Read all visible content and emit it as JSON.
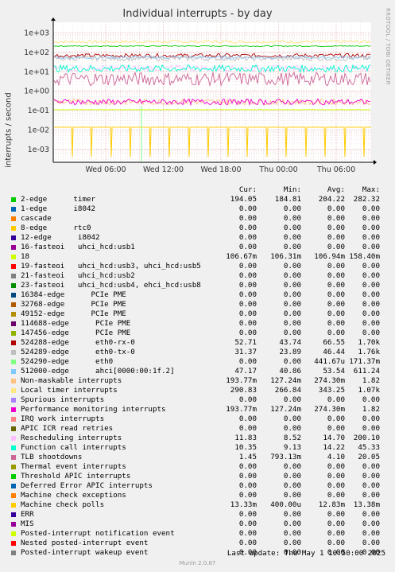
{
  "title": "Individual interrupts - by day",
  "side_label": "RRDTOOL / TOBI OETIKER",
  "version": "Munin 2.0.67",
  "last_update": "Last update: Thu May  1 10:50:00 2025",
  "chart_data": {
    "type": "line",
    "title": "Individual interrupts - by day",
    "ylabel": "interrupts / second",
    "yscale": "log",
    "ylim": [
      0.0005,
      3000
    ],
    "yticks": [
      "1e+03",
      "1e+02",
      "1e+01",
      "1e+00",
      "1e-01",
      "1e-02",
      "1e-03"
    ],
    "ytick_values": [
      1000,
      100,
      10,
      1,
      0.1,
      0.01,
      0.001
    ],
    "xticks": [
      "Wed 06:00",
      "Wed 12:00",
      "Wed 18:00",
      "Thu 00:00",
      "Thu 06:00"
    ],
    "grid": true,
    "series": [
      {
        "name": "2-edge timer",
        "color": "#00cc00",
        "cur": "194.05",
        "min": "184.81",
        "avg": "204.22",
        "max": "282.32"
      },
      {
        "name": "1-edge i8042",
        "color": "#0066b3",
        "cur": "0.00",
        "min": "0.00",
        "avg": "0.00",
        "max": "0.00"
      },
      {
        "name": "cascade",
        "color": "#ff8000",
        "cur": "0.00",
        "min": "0.00",
        "avg": "0.00",
        "max": "0.00"
      },
      {
        "name": "8-edge rtc0",
        "color": "#ffcc00",
        "cur": "0.00",
        "min": "0.00",
        "avg": "0.00",
        "max": "0.00"
      },
      {
        "name": "12-edge i8042",
        "color": "#330099",
        "cur": "0.00",
        "min": "0.00",
        "avg": "0.00",
        "max": "0.00"
      },
      {
        "name": "16-fasteoi uhci_hcd:usb1",
        "color": "#990099",
        "cur": "0.00",
        "min": "0.00",
        "avg": "0.00",
        "max": "0.00"
      },
      {
        "name": "18",
        "color": "#ccff00",
        "cur": "106.67m",
        "min": "106.31m",
        "avg": "106.94m",
        "max": "158.40m"
      },
      {
        "name": "19-fasteoi uhci_hcd:usb3, uhci_hcd:usb5",
        "color": "#ff0000",
        "cur": "0.00",
        "min": "0.00",
        "avg": "0.00",
        "max": "0.00"
      },
      {
        "name": "21-fasteoi uhci_hcd:usb2",
        "color": "#808080",
        "cur": "0.00",
        "min": "0.00",
        "avg": "0.00",
        "max": "0.00"
      },
      {
        "name": "23-fasteoi uhci_hcd:usb4, ehci_hcd:usb8",
        "color": "#008f00",
        "cur": "0.00",
        "min": "0.00",
        "avg": "0.00",
        "max": "0.00"
      },
      {
        "name": "16384-edge PCIe PME",
        "color": "#00487d",
        "cur": "0.00",
        "min": "0.00",
        "avg": "0.00",
        "max": "0.00"
      },
      {
        "name": "32768-edge PCIe PME",
        "color": "#b35a00",
        "cur": "0.00",
        "min": "0.00",
        "avg": "0.00",
        "max": "0.00"
      },
      {
        "name": "49152-edge PCIe PME",
        "color": "#b38f00",
        "cur": "0.00",
        "min": "0.00",
        "avg": "0.00",
        "max": "0.00"
      },
      {
        "name": "114688-edge PCIe PME",
        "color": "#6b006b",
        "cur": "0.00",
        "min": "0.00",
        "avg": "0.00",
        "max": "0.00"
      },
      {
        "name": "147456-edge PCIe PME",
        "color": "#8fb300",
        "cur": "0.00",
        "min": "0.00",
        "avg": "0.00",
        "max": "0.00"
      },
      {
        "name": "524288-edge eth0-rx-0",
        "color": "#b30000",
        "cur": "52.71",
        "min": "43.74",
        "avg": "66.55",
        "max": "1.70k"
      },
      {
        "name": "524289-edge eth0-tx-0",
        "color": "#bebebe",
        "cur": "31.37",
        "min": "23.89",
        "avg": "46.44",
        "max": "1.76k"
      },
      {
        "name": "524290-edge eth0",
        "color": "#80ff80",
        "cur": "0.00",
        "min": "0.00",
        "avg": "441.67u",
        "max": "171.37m"
      },
      {
        "name": "512000-edge ahci[0000:00:1f.2]",
        "color": "#80c9ff",
        "cur": "47.17",
        "min": "40.86",
        "avg": "53.54",
        "max": "611.24"
      },
      {
        "name": "Non-maskable interrupts",
        "color": "#ffc080",
        "cur": "193.77m",
        "min": "127.24m",
        "avg": "274.30m",
        "max": "1.82"
      },
      {
        "name": "Local timer interrupts",
        "color": "#ffe680",
        "cur": "290.83",
        "min": "266.84",
        "avg": "343.25",
        "max": "1.07k"
      },
      {
        "name": "Spurious interrupts",
        "color": "#aa80ff",
        "cur": "0.00",
        "min": "0.00",
        "avg": "0.00",
        "max": "0.00"
      },
      {
        "name": "Performance monitoring interrupts",
        "color": "#ee00cc",
        "cur": "193.77m",
        "min": "127.24m",
        "avg": "274.30m",
        "max": "1.82"
      },
      {
        "name": "IRQ work interrupts",
        "color": "#ff8080",
        "cur": "0.00",
        "min": "0.00",
        "avg": "0.00",
        "max": "0.00"
      },
      {
        "name": "APIC ICR read retries",
        "color": "#666600",
        "cur": "0.00",
        "min": "0.00",
        "avg": "0.00",
        "max": "0.00"
      },
      {
        "name": "Rescheduling interrupts",
        "color": "#ffbfff",
        "cur": "11.83",
        "min": "8.52",
        "avg": "14.70",
        "max": "200.10"
      },
      {
        "name": "Function call interrupts",
        "color": "#00ffcc",
        "cur": "10.35",
        "min": "9.13",
        "avg": "14.22",
        "max": "45.33"
      },
      {
        "name": "TLB shootdowns",
        "color": "#cc6699",
        "cur": "1.45",
        "min": "793.13m",
        "avg": "4.10",
        "max": "20.05"
      },
      {
        "name": "Thermal event interrupts",
        "color": "#999900",
        "cur": "0.00",
        "min": "0.00",
        "avg": "0.00",
        "max": "0.00"
      },
      {
        "name": "Threshold APIC interrupts",
        "color": "#00cc00",
        "cur": "0.00",
        "min": "0.00",
        "avg": "0.00",
        "max": "0.00"
      },
      {
        "name": "Deferred Error APIC interrupts",
        "color": "#0066b3",
        "cur": "0.00",
        "min": "0.00",
        "avg": "0.00",
        "max": "0.00"
      },
      {
        "name": "Machine check exceptions",
        "color": "#ff8000",
        "cur": "0.00",
        "min": "0.00",
        "avg": "0.00",
        "max": "0.00"
      },
      {
        "name": "Machine check polls",
        "color": "#ffcc00",
        "cur": "13.33m",
        "min": "400.00u",
        "avg": "12.83m",
        "max": "13.38m"
      },
      {
        "name": "ERR",
        "color": "#330099",
        "cur": "0.00",
        "min": "0.00",
        "avg": "0.00",
        "max": "0.00"
      },
      {
        "name": "MIS",
        "color": "#990099",
        "cur": "0.00",
        "min": "0.00",
        "avg": "0.00",
        "max": "0.00"
      },
      {
        "name": "Posted-interrupt notification event",
        "color": "#ccff00",
        "cur": "0.00",
        "min": "0.00",
        "avg": "0.00",
        "max": "0.00"
      },
      {
        "name": "Nested posted-interrupt event",
        "color": "#ff0000",
        "cur": "0.00",
        "min": "0.00",
        "avg": "0.00",
        "max": "0.00"
      },
      {
        "name": "Posted-interrupt wakeup event",
        "color": "#808080",
        "cur": "0.00",
        "min": "0.00",
        "avg": "0.00",
        "max": "0.00"
      }
    ]
  },
  "legend_header": {
    "cur": "Cur:",
    "min": "Min:",
    "avg": "Avg:",
    "max": "Max:"
  },
  "legend_rows": [
    {
      "label": "2-edge      timer"
    },
    {
      "label": "1-edge      i8042"
    },
    {
      "label": "cascade"
    },
    {
      "label": "8-edge      rtc0"
    },
    {
      "label": "12-edge      i8042"
    },
    {
      "label": "16-fasteoi   uhci_hcd:usb1"
    },
    {
      "label": "18"
    },
    {
      "label": "19-fasteoi   uhci_hcd:usb3, uhci_hcd:usb5"
    },
    {
      "label": "21-fasteoi   uhci_hcd:usb2"
    },
    {
      "label": "23-fasteoi   uhci_hcd:usb4, ehci_hcd:usb8"
    },
    {
      "label": "16384-edge      PCIe PME"
    },
    {
      "label": "32768-edge      PCIe PME"
    },
    {
      "label": "49152-edge      PCIe PME"
    },
    {
      "label": "114688-edge      PCIe PME"
    },
    {
      "label": "147456-edge      PCIe PME"
    },
    {
      "label": "524288-edge      eth0-rx-0"
    },
    {
      "label": "524289-edge      eth0-tx-0"
    },
    {
      "label": "524290-edge      eth0"
    },
    {
      "label": "512000-edge      ahci[0000:00:1f.2]"
    },
    {
      "label": "Non-maskable interrupts"
    },
    {
      "label": "Local timer interrupts"
    },
    {
      "label": "Spurious interrupts"
    },
    {
      "label": "Performance monitoring interrupts"
    },
    {
      "label": "IRQ work interrupts"
    },
    {
      "label": "APIC ICR read retries"
    },
    {
      "label": "Rescheduling interrupts"
    },
    {
      "label": "Function call interrupts"
    },
    {
      "label": "TLB shootdowns"
    },
    {
      "label": "Thermal event interrupts"
    },
    {
      "label": "Threshold APIC interrupts"
    },
    {
      "label": "Deferred Error APIC interrupts"
    },
    {
      "label": "Machine check exceptions"
    },
    {
      "label": "Machine check polls"
    },
    {
      "label": "ERR"
    },
    {
      "label": "MIS"
    },
    {
      "label": "Posted-interrupt notification event"
    },
    {
      "label": "Nested posted-interrupt event"
    },
    {
      "label": "Posted-interrupt wakeup event"
    }
  ]
}
